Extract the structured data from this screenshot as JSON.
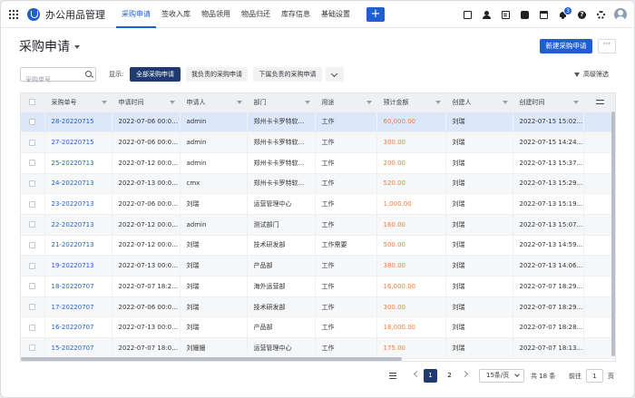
{
  "app": {
    "title": "办公用品管理",
    "nav_tabs": [
      "采购申请",
      "签收入库",
      "物品领用",
      "物品归还",
      "库存信息",
      "基础设置"
    ],
    "active_tab": "采购申请",
    "add_label": "+",
    "notification_count": "3"
  },
  "header": {
    "title": "采购申请",
    "new_button": "新建采购申请",
    "more_button": "···"
  },
  "filters": {
    "search_placeholder": "采购单号",
    "show_label": "显示:",
    "chips": [
      "全部采购申请",
      "我负责的采购申请",
      "下属负责的采购申请"
    ],
    "active_chip": "全部采购申请",
    "advanced": "高级筛选"
  },
  "table": {
    "columns": [
      "采购单号",
      "申请时间",
      "申请人",
      "部门",
      "用途",
      "预计金额",
      "创建人",
      "创建时间"
    ],
    "rows": [
      [
        "28-20220715",
        "2022-07-06 00:00...",
        "admin",
        "郑州卡卡罗特软...",
        "工作",
        "60,000.00",
        "刘瑞",
        "2022-07-15 15:02..."
      ],
      [
        "27-20220715",
        "2022-07-06 00:00...",
        "admin",
        "郑州卡卡罗特软...",
        "工作",
        "300.00",
        "刘瑞",
        "2022-07-15 14:24..."
      ],
      [
        "25-20220713",
        "2022-07-12 00:00...",
        "admin",
        "郑州卡卡罗特软...",
        "工作",
        "200.00",
        "刘瑞",
        "2022-07-13 15:37..."
      ],
      [
        "24-20220713",
        "2022-07-13 00:00...",
        "cmx",
        "郑州卡卡罗特软...",
        "工作",
        "520.00",
        "刘瑞",
        "2022-07-13 15:29..."
      ],
      [
        "23-20220713",
        "2022-07-06 00:00...",
        "刘瑞",
        "运营管理中心",
        "工作",
        "1,000.00",
        "刘瑞",
        "2022-07-13 15:19..."
      ],
      [
        "22-20220713",
        "2022-07-12 00:00...",
        "admin",
        "测试部门",
        "工作",
        "160.00",
        "刘瑞",
        "2022-07-13 15:07..."
      ],
      [
        "21-20220713",
        "2022-07-12 00:00...",
        "刘瑞",
        "技术研发部",
        "工作需要",
        "500.00",
        "刘瑞",
        "2022-07-13 14:59..."
      ],
      [
        "19-20220713",
        "2022-07-13 00:00...",
        "刘瑞",
        "产品部",
        "工作",
        "380.00",
        "刘瑞",
        "2022-07-13 14:06..."
      ],
      [
        "18-20220707",
        "2022-07-07 18:25...",
        "刘瑞",
        "海外运营部",
        "工作",
        "16,000.00",
        "刘瑞",
        "2022-07-07 18:29..."
      ],
      [
        "17-20220707",
        "2022-07-06 00:00...",
        "刘瑞",
        "技术研发部",
        "工作",
        "300.00",
        "刘瑞",
        "2022-07-07 18:29..."
      ],
      [
        "16-20220707",
        "2022-07-13 00:00...",
        "刘瑞",
        "产品部",
        "工作",
        "18,000.00",
        "刘瑞",
        "2022-07-07 18:28..."
      ],
      [
        "15-20220707",
        "2022-07-07 18:09...",
        "刘姗姗",
        "运营管理中心",
        "工作",
        "175.00",
        "刘瑞",
        "2022-07-07 18:13..."
      ]
    ],
    "selected_row": 0
  },
  "pagination": {
    "pages": [
      "1",
      "2"
    ],
    "current_page": "1",
    "page_size": "15条/页",
    "total": "共 18 条",
    "goto_label": "前往",
    "goto_value": "1",
    "goto_unit": "页"
  },
  "colors": {
    "primary": "#1f5fd1",
    "dark_chip": "#1f3a6e",
    "amount": "#f07c3c",
    "selected_row": "#dce8fa"
  }
}
